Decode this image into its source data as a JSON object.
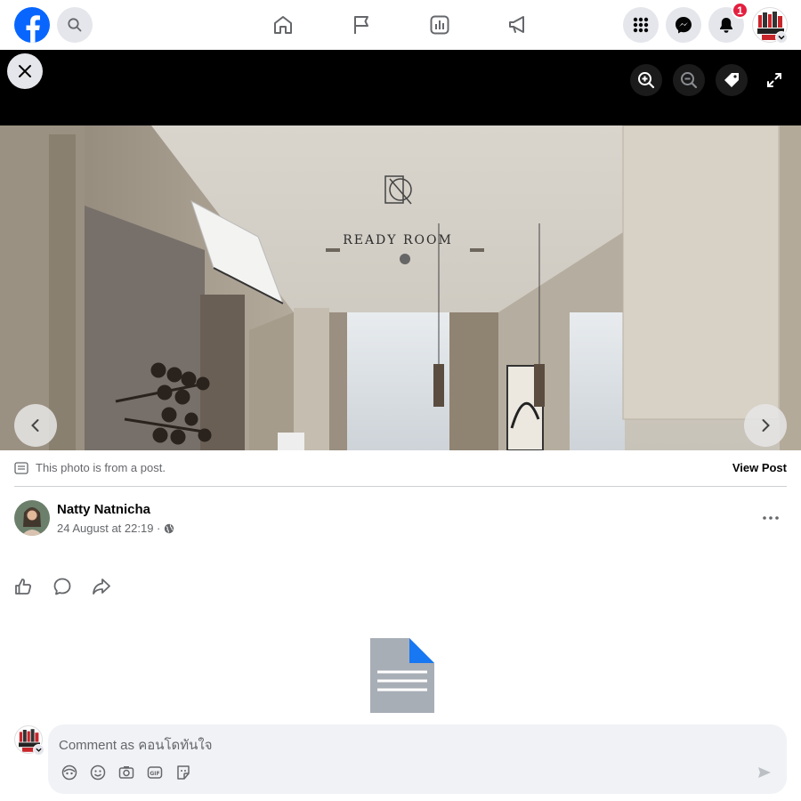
{
  "topbar": {
    "notification_count": "1",
    "profile_name": "คอนโดทันใจ"
  },
  "photo": {
    "brand_text": "READY ROOM"
  },
  "post_info": {
    "from_post_text": "This photo is from a post.",
    "view_post_label": "View Post"
  },
  "post": {
    "author_name": "Natty Natnicha",
    "timestamp": "24 August at 22:19 ·"
  },
  "composer": {
    "placeholder": "Comment as คอนโดทันใจ"
  },
  "colors": {
    "brand_blue": "#0866ff",
    "badge_red": "#e41e3f",
    "doc_gray": "#a8aeb6",
    "doc_blue": "#1877f2"
  }
}
